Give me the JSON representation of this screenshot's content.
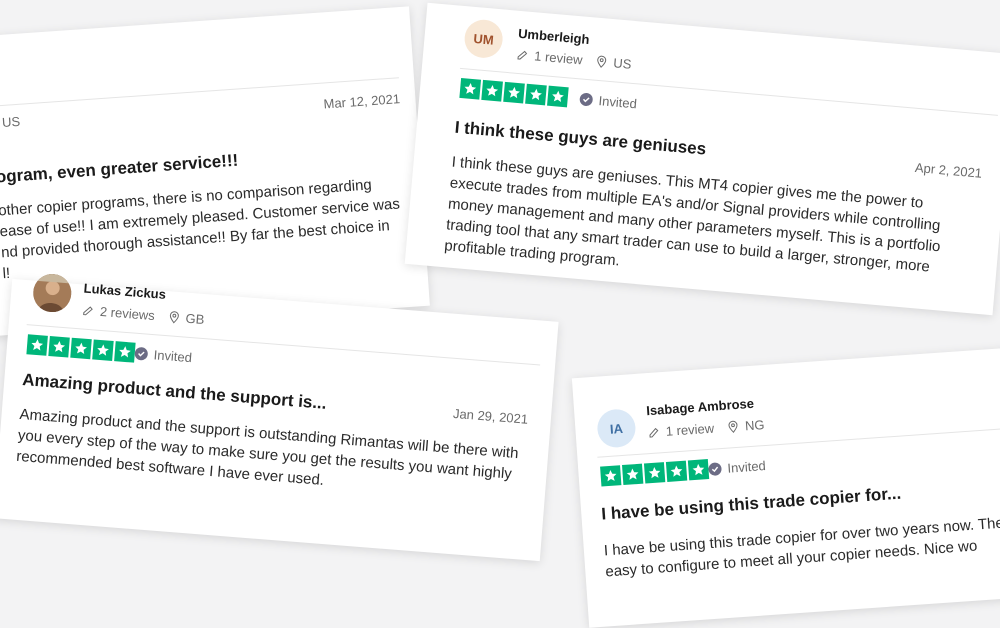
{
  "reviews": [
    {
      "country": "US",
      "date": "Mar 12, 2021",
      "title": "ogram, even greater service!!!",
      "body_lines": [
        "other copier programs, there is no comparison regarding",
        "ease of use!! I am extremely pleased. Customer service was",
        "nd provided thorough assistance!! By far the best choice in",
        "l!"
      ]
    },
    {
      "avatar": "UM",
      "name": "Umberleigh",
      "reviews_count": "1 review",
      "country": "US",
      "rating": 5,
      "status": "Invited",
      "title": "I think these guys are geniuses",
      "date": "Apr 2, 2021",
      "body_lines": [
        "I think these guys are geniuses. This MT4 copier gives me the power to",
        "execute trades from multiple EA's and/or Signal providers while controlling",
        "money management and many other parameters myself. This is a portfolio",
        "trading tool that any smart trader can use to build a larger, stronger, more",
        "profitable trading program."
      ]
    },
    {
      "name": "Lukas Zickus",
      "reviews_count": "2 reviews",
      "country": "GB",
      "rating": 5,
      "status": "Invited",
      "title": "Amazing product and the support is...",
      "date": "Jan 29, 2021",
      "body_lines": [
        "Amazing product and the support is outstanding Rimantas will be there with",
        "you every step of the way to make sure you get the results you want highly",
        "recommended best software I have ever used."
      ]
    },
    {
      "avatar": "IA",
      "name": "Isabage Ambrose",
      "reviews_count": "1 review",
      "country": "NG",
      "rating": 5,
      "status": "Invited",
      "title": "I have be using this trade copier for...",
      "body_lines": [
        "I have be using this trade copier for over two years now. The",
        "easy to configure to meet all your copier needs. Nice wo"
      ]
    }
  ],
  "colors": {
    "star_green": "#00b67a",
    "verified_gray": "#6c6c85"
  },
  "icons": {
    "reviews": "pencil-icon",
    "location": "location-pin-icon",
    "status": "check-circle-icon",
    "rating": "star-icon"
  }
}
